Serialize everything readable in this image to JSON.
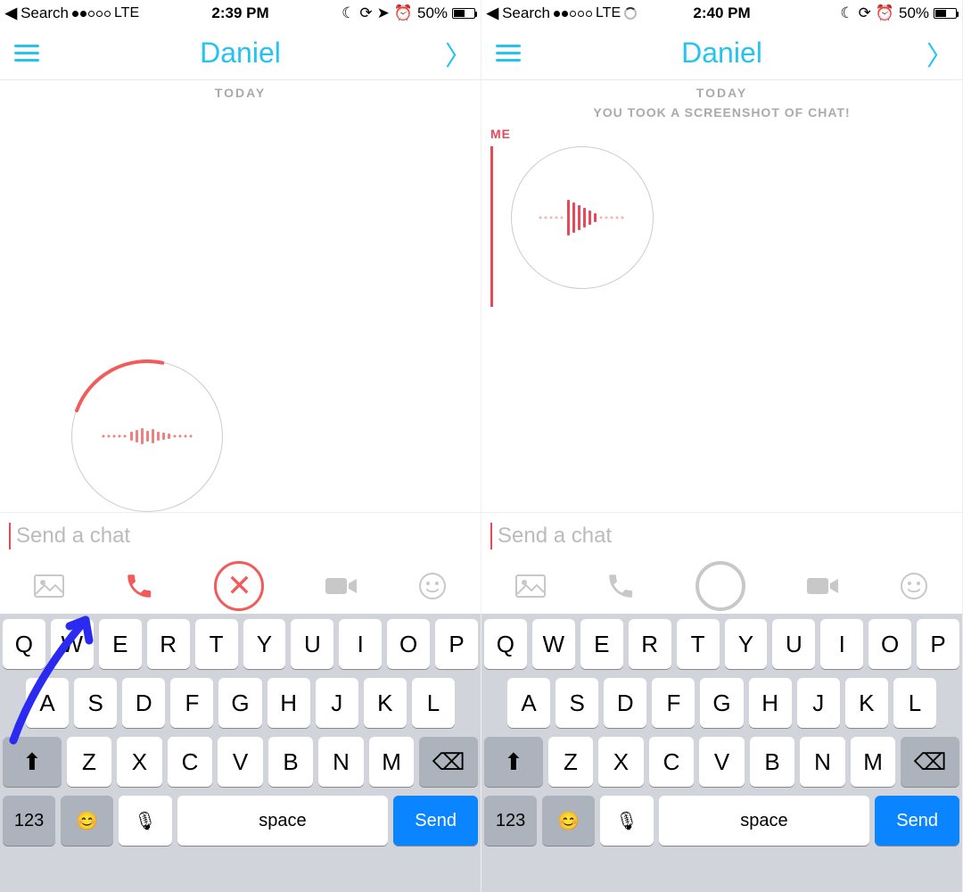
{
  "screens": [
    {
      "statusbar": {
        "back": "Search",
        "carrier": "LTE",
        "time": "2:39 PM",
        "battery_pct": "50%",
        "icons": [
          "moon",
          "lock",
          "location",
          "alarm"
        ]
      },
      "header": {
        "title": "Daniel"
      },
      "chat": {
        "day": "TODAY",
        "sysmsg": null,
        "me_label": null,
        "recording": true
      },
      "input": {
        "placeholder": "Send a chat"
      },
      "toolbar": {
        "call_active": true,
        "center": "cancel"
      },
      "annotation": true
    },
    {
      "statusbar": {
        "back": "Search",
        "carrier": "LTE",
        "time": "2:40 PM",
        "battery_pct": "50%",
        "icons": [
          "moon",
          "lock",
          "alarm"
        ],
        "spinner": true
      },
      "header": {
        "title": "Daniel"
      },
      "chat": {
        "day": "TODAY",
        "sysmsg": "YOU TOOK A SCREENSHOT OF CHAT!",
        "me_label": "ME",
        "recording": false
      },
      "input": {
        "placeholder": "Send a chat"
      },
      "toolbar": {
        "call_active": false,
        "center": "circle"
      },
      "annotation": false
    }
  ],
  "keyboard": {
    "r1": [
      "Q",
      "W",
      "E",
      "R",
      "T",
      "Y",
      "U",
      "I",
      "O",
      "P"
    ],
    "r2": [
      "A",
      "S",
      "D",
      "F",
      "G",
      "H",
      "J",
      "K",
      "L"
    ],
    "r3_shift": "⇧",
    "r3": [
      "Z",
      "X",
      "C",
      "V",
      "B",
      "N",
      "M"
    ],
    "r3_del": "⌫",
    "r4": {
      "nums": "123",
      "emoji": "☺",
      "mic": "🎤",
      "space": "space",
      "send": "Send"
    }
  }
}
